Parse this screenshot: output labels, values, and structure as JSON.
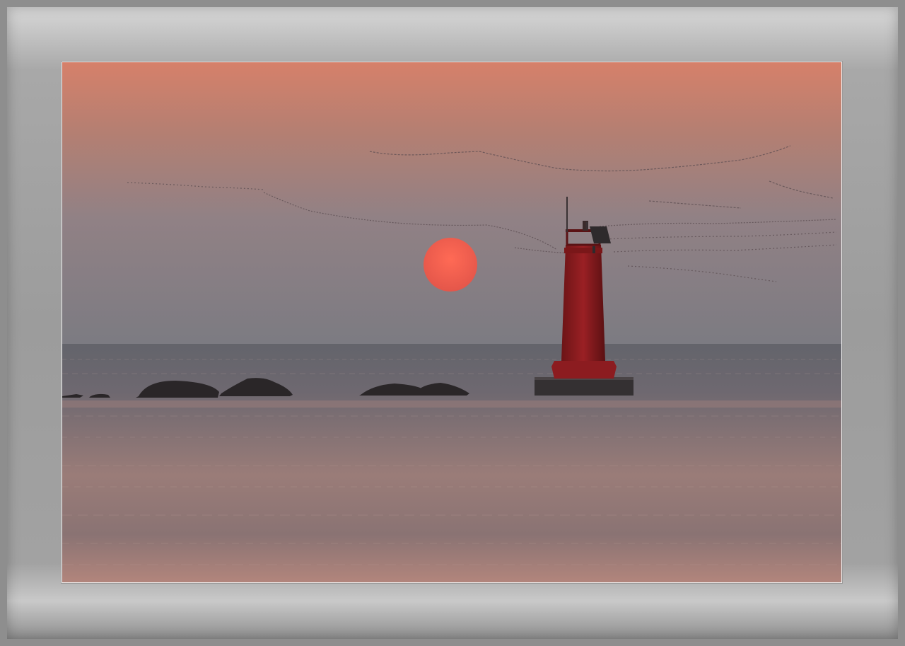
{
  "frame": {
    "mat_color": "#a0a0a0",
    "outer_color": "#8e8e8e"
  },
  "photo": {
    "scene": [
      "sunset-sky",
      "setting-sun",
      "flock-of-birds",
      "red-lighthouse",
      "rocks",
      "sea"
    ],
    "colors": {
      "sky_top": "#d58068",
      "sky_mid": "#9a8583",
      "sky_horizon": "#7e7c82",
      "sun": "#f25d4c",
      "lighthouse": "#8a1a1e",
      "sea": "#5f6066",
      "sea_reflection": "#b2857c"
    }
  }
}
